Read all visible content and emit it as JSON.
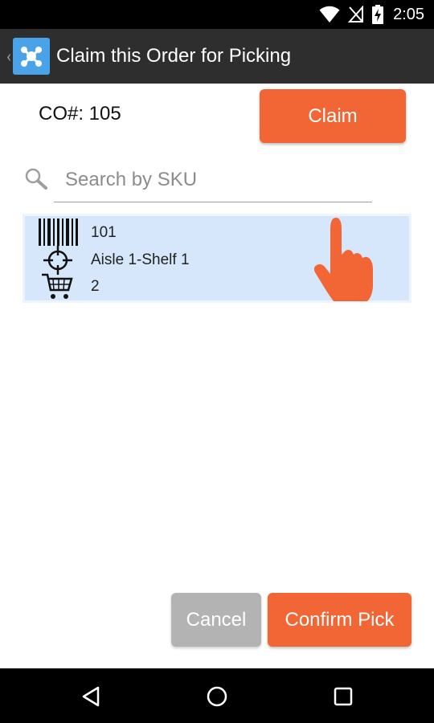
{
  "status_bar": {
    "time": "2:05",
    "icons": [
      "wifi-icon",
      "no-signal-icon",
      "battery-charging-icon"
    ]
  },
  "action_bar": {
    "title": "Claim this Order for Picking",
    "up_icon": "chevron-left-icon",
    "app_icon": "app-logo-icon"
  },
  "order": {
    "co_label": "CO#: 105",
    "claim_label": "Claim"
  },
  "search": {
    "placeholder": "Search by SKU",
    "value": ""
  },
  "items": [
    {
      "sku": "101",
      "location": "Aisle 1-Shelf 1",
      "quantity": "2"
    }
  ],
  "actions": {
    "cancel_label": "Cancel",
    "confirm_label": "Confirm Pick"
  },
  "nav": {
    "back": "back-icon",
    "home": "home-icon",
    "recents": "recents-icon"
  },
  "colors": {
    "accent": "#f26534",
    "action_bar": "#2e2e2e",
    "item_bg": "#d6e7fb",
    "disabled": "#b3b3b3"
  }
}
